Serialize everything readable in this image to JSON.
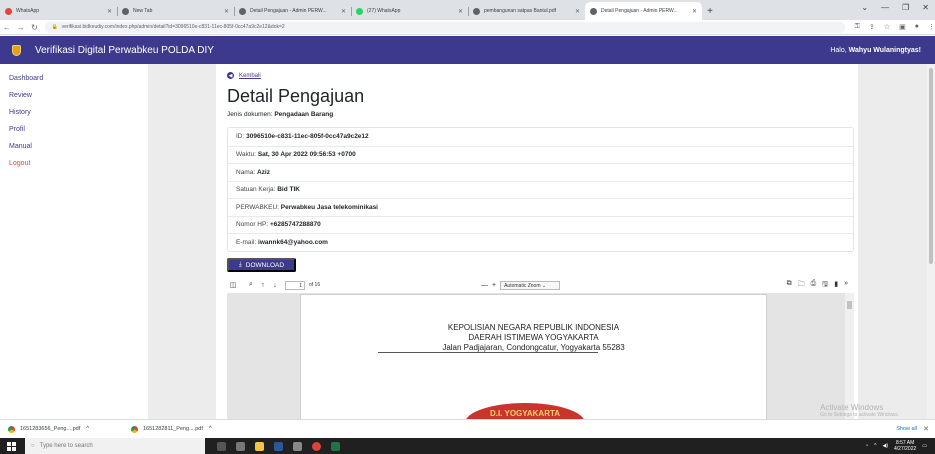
{
  "browser": {
    "tabs": [
      {
        "title": "WhatsApp",
        "favicon_color": "#e2453c",
        "active": false
      },
      {
        "title": "New Tab",
        "favicon_color": "#5f6368",
        "active": false
      },
      {
        "title": "Detail Pengajuan - Admin PERW...",
        "favicon_color": "#5f6368",
        "active": false
      },
      {
        "title": "(27) WhatsApp",
        "favicon_color": "#25d366",
        "active": false
      },
      {
        "title": "pembangunan satpas Bantul.pdf",
        "favicon_color": "#5f6368",
        "active": false
      },
      {
        "title": "Detail Pengajuan - Admin PERW...",
        "favicon_color": "#5f6368",
        "active": true
      }
    ],
    "url": "verifikasi.bidkeudiy.com/index.php/admin/detail?id=3096510e-c831-11ec-805f-0cc47a9c2e12&dok=2"
  },
  "app": {
    "title": "Verifikasi Digital Perwabkeu POLDA DIY",
    "greeting_prefix": "Halo,",
    "user_name": "Wahyu Wulaningtyas!",
    "brand_color": "#3d3a8d"
  },
  "sidebar": {
    "items": [
      {
        "label": "Dashboard"
      },
      {
        "label": "Review"
      },
      {
        "label": "History"
      },
      {
        "label": "Profil"
      },
      {
        "label": "Manual"
      },
      {
        "label": "Logout"
      }
    ]
  },
  "detail": {
    "back_label": "Kembali",
    "title": "Detail Pengajuan",
    "doc_type_label": "Jenis dokumen:",
    "doc_type_value": "Pengadaan Barang",
    "fields": [
      {
        "label": "ID:",
        "value": "3096510e-c831-11ec-805f-0cc47a9c2e12"
      },
      {
        "label": "Waktu:",
        "value": "Sat, 30 Apr 2022 09:56:53 +0700"
      },
      {
        "label": "Nama:",
        "value": "Aziz"
      },
      {
        "label": "Satuan Kerja:",
        "value": "Bid TIK"
      },
      {
        "label": "PERWABKEU:",
        "value": "Perwabkeu Jasa telekominikasi"
      },
      {
        "label": "Nomor HP:",
        "value": "+6285747288870"
      },
      {
        "label": "E-mail:",
        "value": "iwannk64@yahoo.com"
      }
    ],
    "download_label": "DOWNLOAD"
  },
  "pdf": {
    "page_number": "1",
    "page_of": "of 16",
    "zoom": "Automatic Zoom",
    "letterhead": [
      "KEPOLISIAN  NEGARA REPUBLIK INDONESIA",
      "DAERAH ISTIMEWA YOGYAKARTA",
      "Jalan Padjajaran, Condongcatur, Yogyakarta 55283"
    ],
    "seal_text": "D.I. YOGYAKARTA"
  },
  "watermark": {
    "title": "Activate Windows",
    "subtitle": "Go to Settings to activate Windows."
  },
  "downloads": {
    "items": [
      {
        "name": "1651283656_Peng....pdf"
      },
      {
        "name": "1651282811_Peng....pdf"
      }
    ],
    "show_all": "Show all"
  },
  "taskbar": {
    "search_placeholder": "Type here to search",
    "time": "8:57 AM",
    "date": "4/27/2022"
  }
}
